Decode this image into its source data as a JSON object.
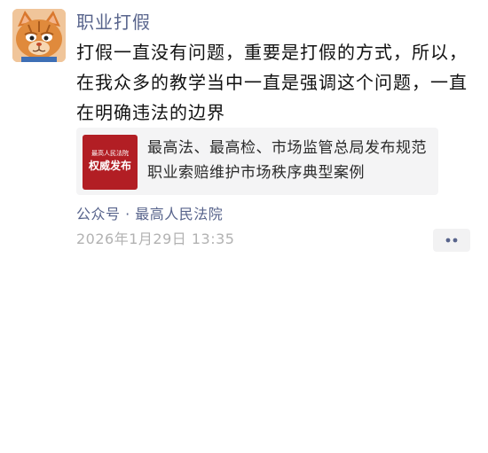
{
  "post": {
    "author": "职业打假",
    "text": "打假一直没有问题，重要是打假的方式，所以，在我众多的教学当中一直是强调这个问题，一直在明确违法的边界",
    "timestamp": "2026年1月29日 13:35"
  },
  "link": {
    "thumb_line1": "最高人民法院",
    "thumb_line2": "权威发布",
    "title": "最高法、最高检、市场监管总局发布规范职业索赔维护市场秩序典型案例",
    "source": "公众号 · 最高人民法院"
  },
  "colors": {
    "name_blue": "#58648c",
    "thumb_red": "#b21e24",
    "time_gray": "#b2b2b2"
  },
  "icons": {
    "avatar": "cat-avatar",
    "more": "more-dots-icon"
  }
}
